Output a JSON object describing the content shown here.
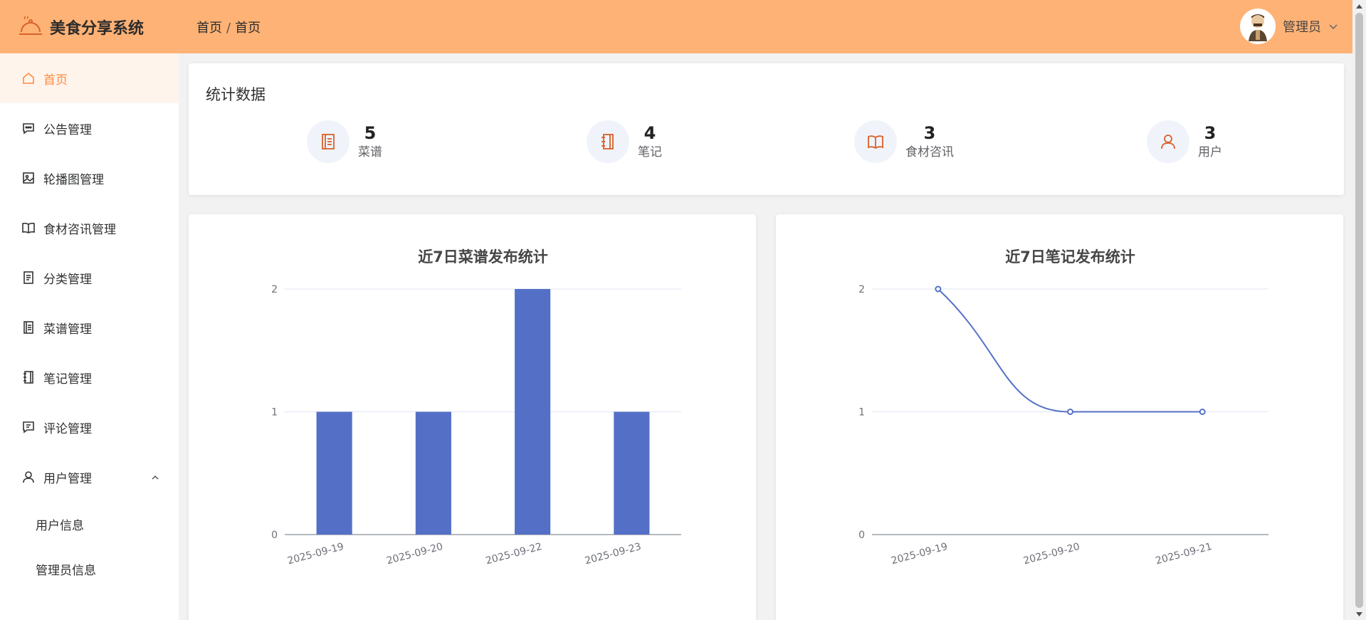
{
  "app": {
    "title": "美食分享系统"
  },
  "breadcrumb": {
    "first": "首页",
    "separator": "/",
    "second": "首页"
  },
  "user": {
    "name": "管理员"
  },
  "sidebar": {
    "items": [
      {
        "label": "首页",
        "icon": "home-icon",
        "active": true
      },
      {
        "label": "公告管理",
        "icon": "chat-icon"
      },
      {
        "label": "轮播图管理",
        "icon": "picture-icon"
      },
      {
        "label": "食材咨讯管理",
        "icon": "book-open-icon"
      },
      {
        "label": "分类管理",
        "icon": "document-icon"
      },
      {
        "label": "菜谱管理",
        "icon": "notebook-icon"
      },
      {
        "label": "笔记管理",
        "icon": "notebook-spiral-icon"
      },
      {
        "label": "评论管理",
        "icon": "comment-icon"
      },
      {
        "label": "用户管理",
        "icon": "user-icon",
        "expanded": true
      }
    ],
    "sub_items": [
      {
        "label": "用户信息"
      },
      {
        "label": "管理员信息"
      }
    ]
  },
  "stats": {
    "title": "统计数据",
    "items": [
      {
        "value": "5",
        "label": "菜谱",
        "icon": "recipe-icon"
      },
      {
        "value": "4",
        "label": "笔记",
        "icon": "notebook-icon"
      },
      {
        "value": "3",
        "label": "食材咨讯",
        "icon": "book-open-icon"
      },
      {
        "value": "3",
        "label": "用户",
        "icon": "user-icon"
      }
    ]
  },
  "colors": {
    "header": "#ffb275",
    "accent": "#ff8a3d",
    "icon": "#d9602a",
    "series": "#5470c6"
  },
  "chart_data": [
    {
      "type": "bar",
      "title": "近7日菜谱发布统计",
      "categories": [
        "2025-09-19",
        "2025-09-20",
        "2025-09-22",
        "2025-09-23"
      ],
      "values": [
        1,
        1,
        2,
        1
      ],
      "ylim": [
        0,
        2
      ],
      "yticks": [
        "0",
        "1",
        "2"
      ],
      "grid": true
    },
    {
      "type": "line",
      "title": "近7日笔记发布统计",
      "categories": [
        "2025-09-19",
        "2025-09-20",
        "2025-09-21"
      ],
      "values": [
        2,
        1,
        1
      ],
      "ylim": [
        0,
        2
      ],
      "yticks": [
        "0",
        "1",
        "2"
      ],
      "smooth": true,
      "grid": true
    }
  ]
}
